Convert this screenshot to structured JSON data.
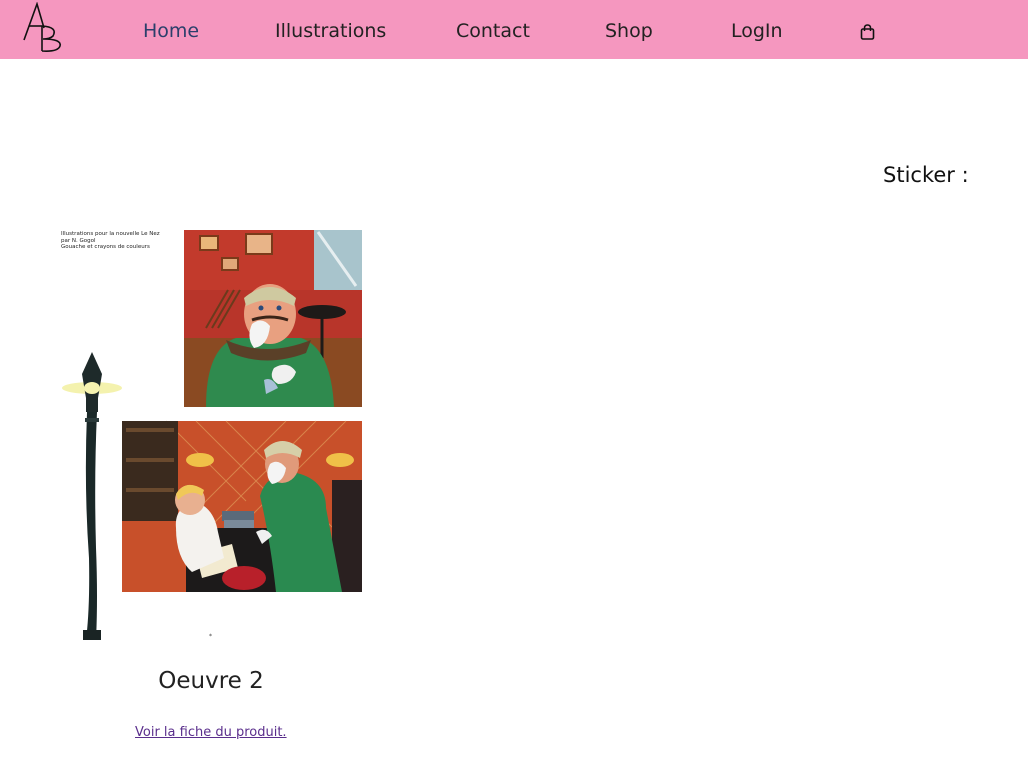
{
  "nav": {
    "logo_text": "AB",
    "links": [
      "Home",
      "Illustrations",
      "Contact",
      "Shop",
      "LogIn"
    ],
    "active": "Home",
    "cart_icon": "shopping-bag-icon"
  },
  "colors": {
    "nav_background": "#f597bf",
    "active_link": "#2b3f6b",
    "product_link": "#5a2e8c"
  },
  "main": {
    "sticker_label": "Sticker :",
    "artwork": {
      "caption_lines": [
        "Illustrations pour la nouvelle Le Nez",
        "par N. Gogol",
        "Gouache et crayons de couleurs"
      ],
      "tiny_mark": "*"
    },
    "product": {
      "title": "Oeuvre 2",
      "link_text": "Voir la fiche du produit."
    }
  }
}
